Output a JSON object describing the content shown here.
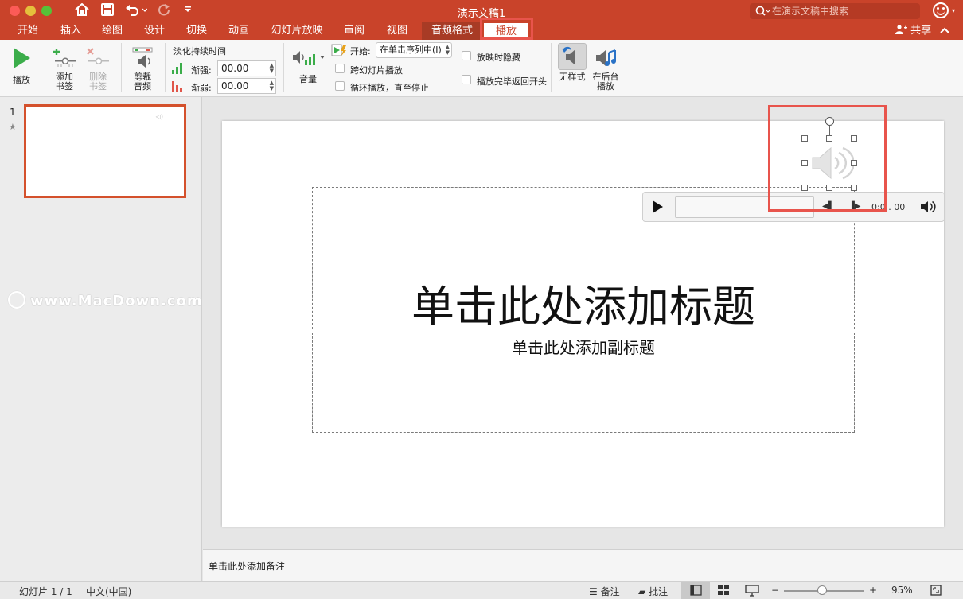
{
  "window": {
    "title": "演示文稿1",
    "search_placeholder": "在演示文稿中搜索"
  },
  "tabs": [
    "开始",
    "插入",
    "绘图",
    "设计",
    "切换",
    "动画",
    "幻灯片放映",
    "审阅",
    "视图",
    "音频格式",
    "播放"
  ],
  "active_tab": "播放",
  "share_label": "共享",
  "ribbon": {
    "play": "播放",
    "add_bookmark": [
      "添加",
      "书签"
    ],
    "remove_bookmark": [
      "删除",
      "书签"
    ],
    "trim_audio": [
      "剪裁",
      "音频"
    ],
    "fade_duration_label": "淡化持续时间",
    "fade_in_label": "渐强:",
    "fade_in_value": "00.00",
    "fade_out_label": "渐弱:",
    "fade_out_value": "00.00",
    "volume": "音量",
    "start_label": "开始:",
    "start_value": "在单击序列中(I)",
    "play_across_slides": "跨幻灯片播放",
    "loop_until_stopped": "循环播放，直至停止",
    "hide_during_show": "放映时隐藏",
    "rewind_after_playing": "播放完毕返回开头",
    "no_style": "无样式",
    "play_in_background": [
      "在后台",
      "播放"
    ]
  },
  "thumbnail": {
    "number": "1"
  },
  "watermark": "www.MacDown.com",
  "slide": {
    "title_placeholder": "单击此处添加标题",
    "subtitle_placeholder": "单击此处添加副标题"
  },
  "player": {
    "time": "0:0 . 00"
  },
  "notes_placeholder": "单击此处添加备注",
  "status": {
    "slide_indicator": "幻灯片 1 / 1",
    "language": "中文(中国)",
    "notes": "备注",
    "comments": "批注",
    "zoom": "95%",
    "zoom_fraction": 0.45
  },
  "colors": {
    "accent": "#c9432a",
    "highlight_box": "#e8544c",
    "play_green": "#3bad4a"
  }
}
